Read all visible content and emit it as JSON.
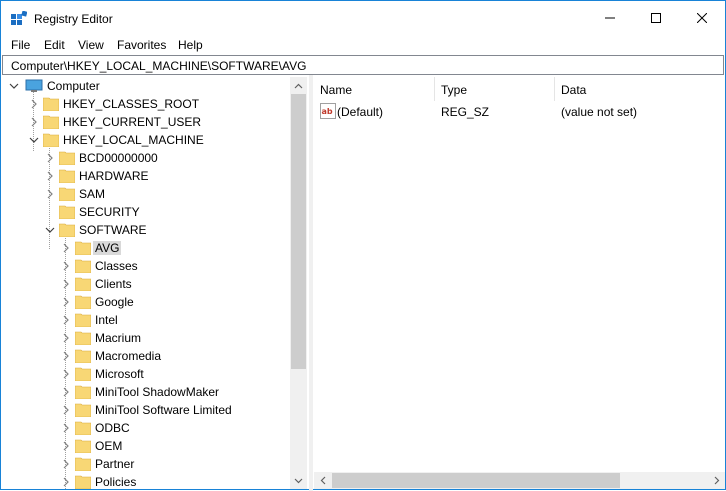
{
  "window": {
    "title": "Registry Editor",
    "accent_color": "#1883d7"
  },
  "menu": [
    "File",
    "Edit",
    "View",
    "Favorites",
    "Help"
  ],
  "address": "Computer\\HKEY_LOCAL_MACHINE\\SOFTWARE\\AVG",
  "tree": {
    "root": "Computer",
    "hives": [
      "HKEY_CLASSES_ROOT",
      "HKEY_CURRENT_USER",
      "HKEY_LOCAL_MACHINE"
    ],
    "hklm_children": [
      "BCD00000000",
      "HARDWARE",
      "SAM",
      "SECURITY",
      "SOFTWARE"
    ],
    "software_children": [
      "AVG",
      "Classes",
      "Clients",
      "Google",
      "Intel",
      "Macrium",
      "Macromedia",
      "Microsoft",
      "MiniTool ShadowMaker",
      "MiniTool Software Limited",
      "ODBC",
      "OEM",
      "Partner",
      "Policies"
    ],
    "selected": "AVG"
  },
  "values": {
    "columns": [
      "Name",
      "Type",
      "Data"
    ],
    "rows": [
      {
        "name": "(Default)",
        "type": "REG_SZ",
        "data": "(value not set)",
        "icon": "string-value-icon"
      }
    ]
  },
  "colors": {
    "folder": "#f8d775",
    "selection": "#d9d9d9",
    "scrollbar": "#f0f0f0",
    "scroll_thumb": "#cdcdcd"
  }
}
